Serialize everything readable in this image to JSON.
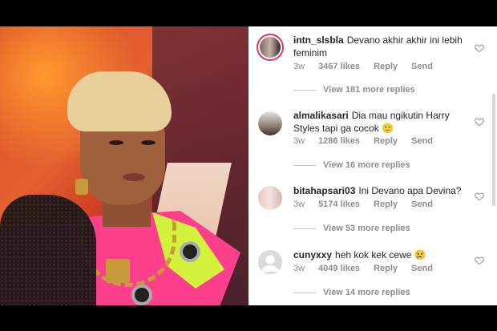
{
  "comments": [
    {
      "username": "intn_slsbla",
      "text": "Devano akhir akhir ini lebih feminim",
      "time": "3w",
      "likes": "3467 likes",
      "reply": "Reply",
      "send": "Send",
      "replies": "View 181 more replies",
      "avatar_icon": "profile-photo-couple",
      "has_story_ring": true
    },
    {
      "username": "almalikasari",
      "text": "Dia mau ngikutin Harry Styles tapi ga cocok 🙂",
      "time": "3w",
      "likes": "1286 likes",
      "reply": "Reply",
      "send": "Send",
      "replies": "View 16 more replies",
      "avatar_icon": "profile-photo-woman"
    },
    {
      "username": "bitahapsari03",
      "text": "Ini Devano apa Devina?",
      "time": "3w",
      "likes": "5174 likes",
      "reply": "Reply",
      "send": "Send",
      "replies": "View 53 more replies",
      "avatar_icon": "profile-photo-two-girls"
    },
    {
      "username": "cunyxxy",
      "text": "heh kok kek cewe 😢",
      "time": "3w",
      "likes": "4049 likes",
      "reply": "Reply",
      "send": "Send",
      "replies": "View 14 more replies",
      "avatar_icon": "default-avatar"
    }
  ],
  "colors": {
    "story_ring": "#d8346a",
    "text": "#262626",
    "muted": "#8e8e8e"
  },
  "icons": {
    "like": "heart-outline-icon"
  }
}
